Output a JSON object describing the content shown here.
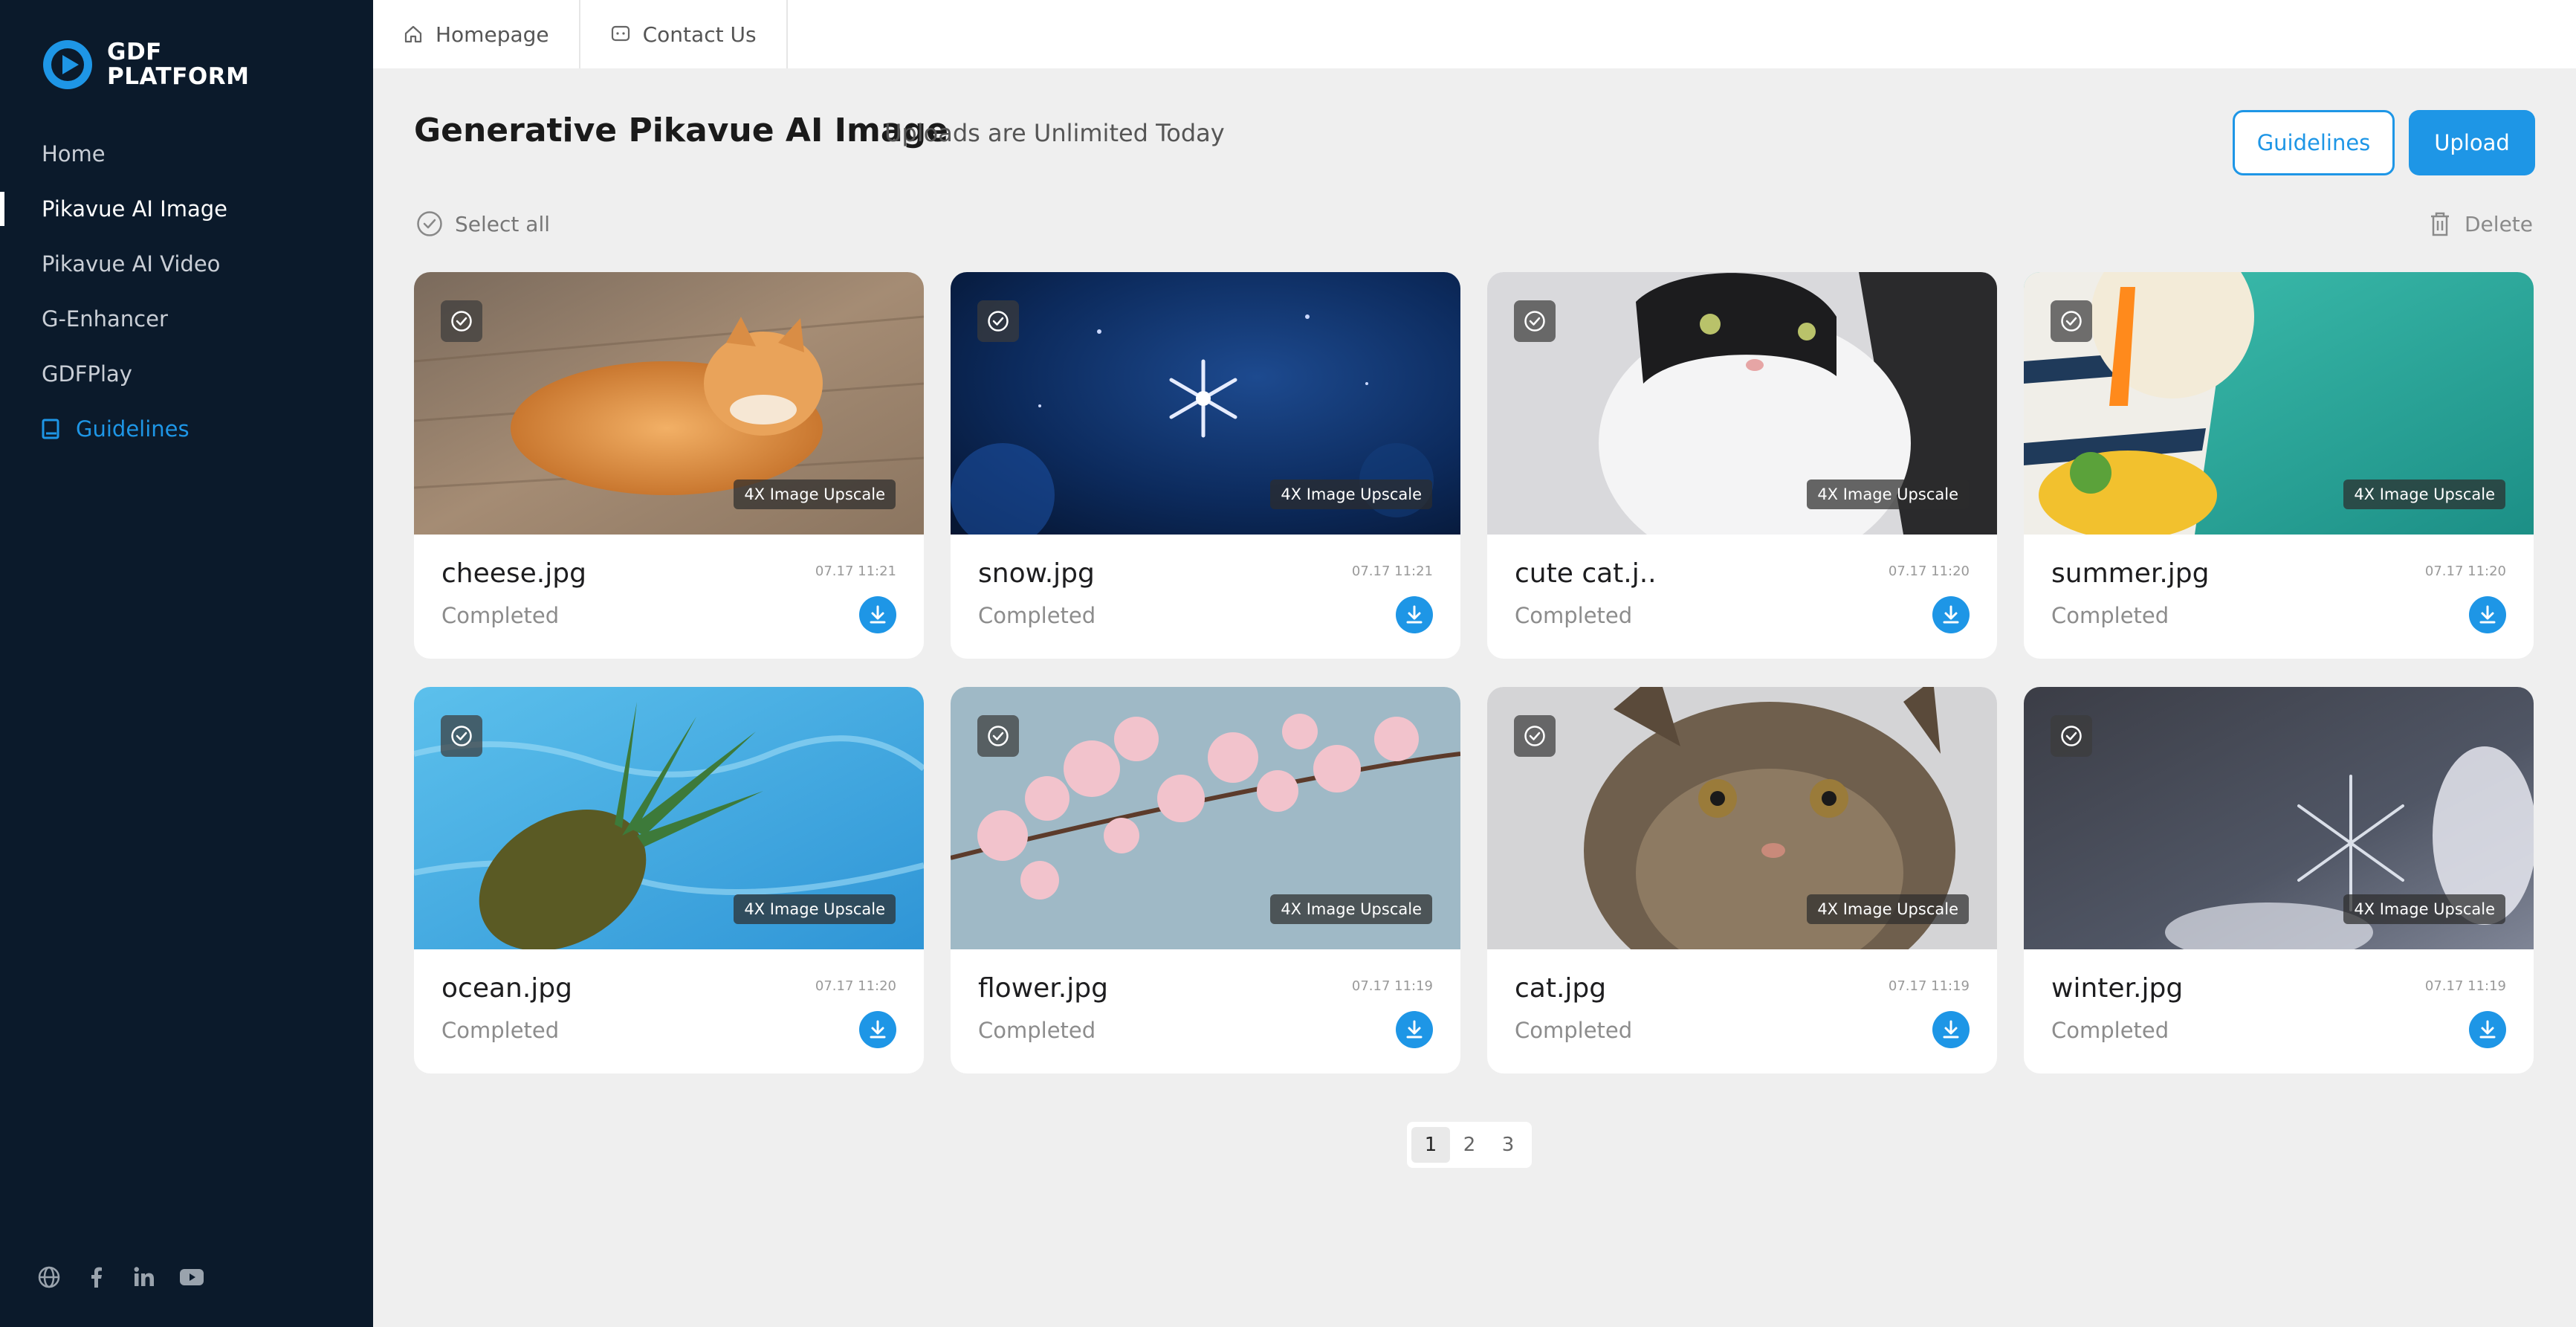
{
  "brand": {
    "line1": "GDF",
    "line2": "PLATFORM",
    "accent": "#1e96e6",
    "sidebar_bg": "#0b1a2b"
  },
  "sidebar": {
    "items": [
      {
        "label": "Home",
        "active": false
      },
      {
        "label": "Pikavue AI Image",
        "active": true
      },
      {
        "label": "Pikavue AI Video",
        "active": false
      },
      {
        "label": "G-Enhancer",
        "active": false
      },
      {
        "label": "GDFPlay",
        "active": false
      },
      {
        "label": "Guidelines",
        "active": false,
        "icon": "book-icon"
      }
    ],
    "social": [
      "globe-icon",
      "facebook-icon",
      "linkedin-icon",
      "youtube-icon"
    ]
  },
  "topbar": {
    "tabs": [
      {
        "label": "Homepage",
        "icon": "home-icon"
      },
      {
        "label": "Contact Us",
        "icon": "chat-icon"
      }
    ]
  },
  "header": {
    "title": "Generative Pikavue AI Image",
    "subtitle": "Uploads are Unlimited Today",
    "guidelines_label": "Guidelines",
    "upload_label": "Upload"
  },
  "toolbar": {
    "select_all": "Select all",
    "delete": "Delete"
  },
  "cards": [
    {
      "name": "cheese.jpg",
      "status": "Completed",
      "date": "07.17 11:21",
      "badge": "4X Image Upscale"
    },
    {
      "name": "snow.jpg",
      "status": "Completed",
      "date": "07.17 11:21",
      "badge": "4X Image Upscale"
    },
    {
      "name": "cute cat.j..",
      "status": "Completed",
      "date": "07.17 11:20",
      "badge": "4X Image Upscale"
    },
    {
      "name": "summer.jpg",
      "status": "Completed",
      "date": "07.17 11:20",
      "badge": "4X Image Upscale"
    },
    {
      "name": "ocean.jpg",
      "status": "Completed",
      "date": "07.17 11:20",
      "badge": "4X Image Upscale"
    },
    {
      "name": "flower.jpg",
      "status": "Completed",
      "date": "07.17 11:19",
      "badge": "4X Image Upscale"
    },
    {
      "name": "cat.jpg",
      "status": "Completed",
      "date": "07.17 11:19",
      "badge": "4X Image Upscale"
    },
    {
      "name": "winter.jpg",
      "status": "Completed",
      "date": "07.17 11:19",
      "badge": "4X Image Upscale"
    }
  ],
  "pagination": {
    "pages": [
      "1",
      "2",
      "3"
    ],
    "current": "1"
  }
}
